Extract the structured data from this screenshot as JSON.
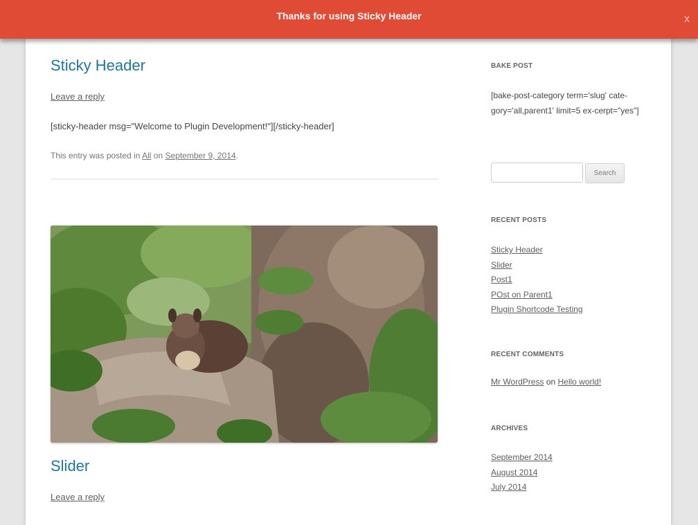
{
  "sticky_header": {
    "message": "Thanks for using Sticky Header",
    "close_label": "x"
  },
  "posts": [
    {
      "title": "Sticky Header",
      "leave_reply": "Leave a reply",
      "content": "[sticky-header msg=\"Welcome to Plugin Development!\"][/sticky-header]",
      "meta_prefix": "This entry was posted in",
      "category": "All",
      "meta_on": "on",
      "date": "September 9, 2014",
      "meta_end": "."
    },
    {
      "title": "Slider",
      "leave_reply": "Leave a reply"
    }
  ],
  "sidebar": {
    "bake_post": {
      "title": "BAKE POST",
      "text": "[bake-post-category term='slug' cate-gory='all,parent1' limit=5 ex-cerpt=\"yes\"]"
    },
    "search": {
      "placeholder": "",
      "button_label": "Search"
    },
    "recent_posts": {
      "title": "RECENT POSTS",
      "items": [
        "Sticky Header",
        "Slider",
        "Post1",
        "POst on Parent1",
        "Plugin Shortcode Testing"
      ]
    },
    "recent_comments": {
      "title": "RECENT COMMENTS",
      "author": "Mr WordPress",
      "on": "on",
      "post": "Hello world!"
    },
    "archives": {
      "title": "ARCHIVES",
      "items": [
        "September 2014",
        "August 2014",
        "July 2014"
      ]
    }
  },
  "colors": {
    "sticky_bar": "#e04b35",
    "title_link": "#21759b"
  },
  "icons": [
    "close-icon"
  ]
}
